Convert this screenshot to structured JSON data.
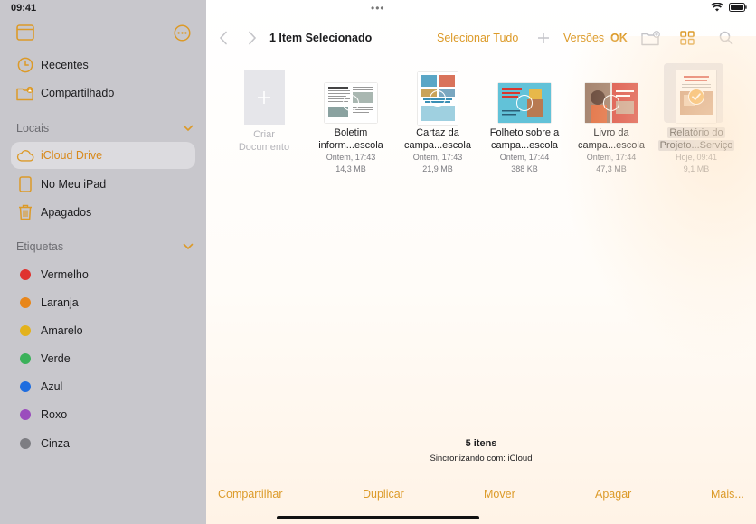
{
  "status": {
    "time": "09:41",
    "multitask": "•••"
  },
  "sidebar": {
    "top_items": [
      {
        "label": "Recentes",
        "icon": "clock-icon"
      },
      {
        "label": "Compartilhado",
        "icon": "shared-folder-icon"
      }
    ],
    "locations_title": "Locais",
    "locations": [
      {
        "label": "iCloud Drive",
        "icon": "cloud-icon",
        "active": true
      },
      {
        "label": "No Meu iPad",
        "icon": "ipad-icon"
      },
      {
        "label": "Apagados",
        "icon": "trash-icon"
      }
    ],
    "tags_title": "Etiquetas",
    "tags": [
      {
        "label": "Vermelho",
        "color": "#e0322f"
      },
      {
        "label": "Laranja",
        "color": "#e8861a"
      },
      {
        "label": "Amarelo",
        "color": "#e3b21c"
      },
      {
        "label": "Verde",
        "color": "#3bb15a"
      },
      {
        "label": "Azul",
        "color": "#1f6ddf"
      },
      {
        "label": "Roxo",
        "color": "#9b4dbd"
      },
      {
        "label": "Cinza",
        "color": "#7d7d82"
      }
    ]
  },
  "toolbar": {
    "title": "1 Item Selecionado",
    "select_all": "Selecionar Tudo",
    "add": "+",
    "versions": "Versões",
    "ok": "OK"
  },
  "files": [
    {
      "kind": "create",
      "name": [
        "Criar",
        "Documento"
      ]
    },
    {
      "name": [
        "Boletim",
        "inform...escola"
      ],
      "date": "Ontem, 17:43",
      "size": "14,3 MB"
    },
    {
      "name": [
        "Cartaz da",
        "campa...escola"
      ],
      "date": "Ontem, 17:43",
      "size": "21,9 MB"
    },
    {
      "name": [
        "Folheto sobre a",
        "campa...escola"
      ],
      "date": "Ontem, 17:44",
      "size": "388 KB"
    },
    {
      "name": [
        "Livro da",
        "campa...escola"
      ],
      "date": "Ontem, 17:44",
      "size": "47,3 MB"
    },
    {
      "name": [
        "Relatório do",
        "Projeto...Serviço"
      ],
      "date": "Hoje, 09:41",
      "size": "9,1 MB",
      "selected": true
    }
  ],
  "footer": {
    "count": "5 itens",
    "sync": "Sincronizando com: iCloud"
  },
  "bottombar": {
    "share": "Compartilhar",
    "duplicate": "Duplicar",
    "move": "Mover",
    "delete": "Apagar",
    "more": "Mais..."
  },
  "colors": {
    "accent": "#dc9a28",
    "sidebar_bg": "#c8c7cc"
  }
}
